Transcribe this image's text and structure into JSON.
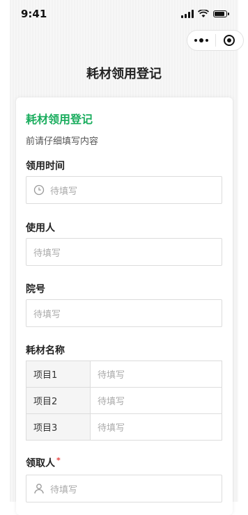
{
  "status_bar": {
    "time": "9:41"
  },
  "nav": {
    "title": "耗材领用登记"
  },
  "form": {
    "title": "耗材领用登记",
    "description": "前请仔细填写内容",
    "fields": {
      "time": {
        "label": "领用时间",
        "placeholder": "待填写",
        "icon": "clock-icon"
      },
      "user": {
        "label": "使用人",
        "placeholder": "待填写"
      },
      "hospital_no": {
        "label": "院号",
        "placeholder": "待填写"
      },
      "materials": {
        "label": "耗材名称",
        "items": [
          {
            "name": "项目1",
            "placeholder": "待填写"
          },
          {
            "name": "项目2",
            "placeholder": "待填写"
          },
          {
            "name": "项目3",
            "placeholder": "待填写"
          }
        ]
      },
      "receiver": {
        "label": "领取人",
        "required_mark": "*",
        "placeholder": "待填写",
        "icon": "person-icon"
      }
    }
  },
  "colors": {
    "accent": "#1aad5e",
    "required": "#e64340"
  }
}
